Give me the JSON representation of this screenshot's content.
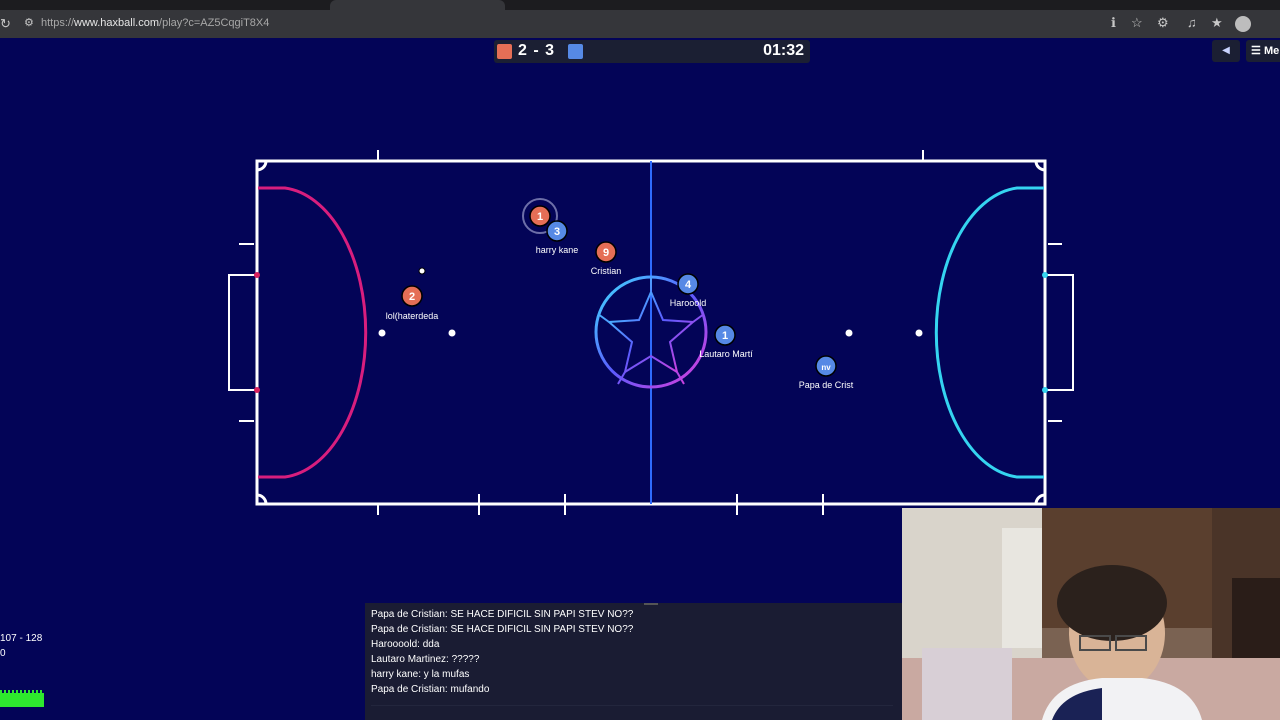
{
  "browser": {
    "url_prefix": "https://",
    "url_host": "www.haxball.com",
    "url_path": "/play?c=AZ5CqgiT8X4"
  },
  "scoreboard": {
    "score": "2 - 3",
    "timer": "01:32",
    "red_color": "#e56e56",
    "blue_color": "#5689e5",
    "menu_label": "Me"
  },
  "players": [
    {
      "team": "red",
      "number": "1",
      "name": ""
    },
    {
      "team": "blue",
      "number": "3",
      "name": "harry kane"
    },
    {
      "team": "red",
      "number": "9",
      "name": "Cristian"
    },
    {
      "team": "red",
      "number": "2",
      "name": "lol(haterdeda"
    },
    {
      "team": "blue",
      "number": "4",
      "name": "Harooold"
    },
    {
      "team": "blue",
      "number": "1",
      "name": "Lautaro Martí"
    },
    {
      "team": "blue",
      "number": "nv",
      "name": "Papa de Crist"
    }
  ],
  "chat": {
    "messages": [
      "Papa de Cristian: SE HACE DIFICIL SIN PAPI STEV NO??",
      "Papa de Cristian: SE HACE DIFICIL SIN PAPI STEV NO??",
      "Haroooold: dda",
      "Lautaro Martinez: ?????",
      "harry kane: y la mufas",
      "Papa de Cristian: mufando"
    ]
  },
  "stats": {
    "line1": "107 - 128",
    "line2": "0"
  },
  "field_colors": {
    "red_area": "#d81e7e",
    "blue_area": "#35d4f0",
    "midline": "#2f6bff",
    "background": "#030457"
  }
}
